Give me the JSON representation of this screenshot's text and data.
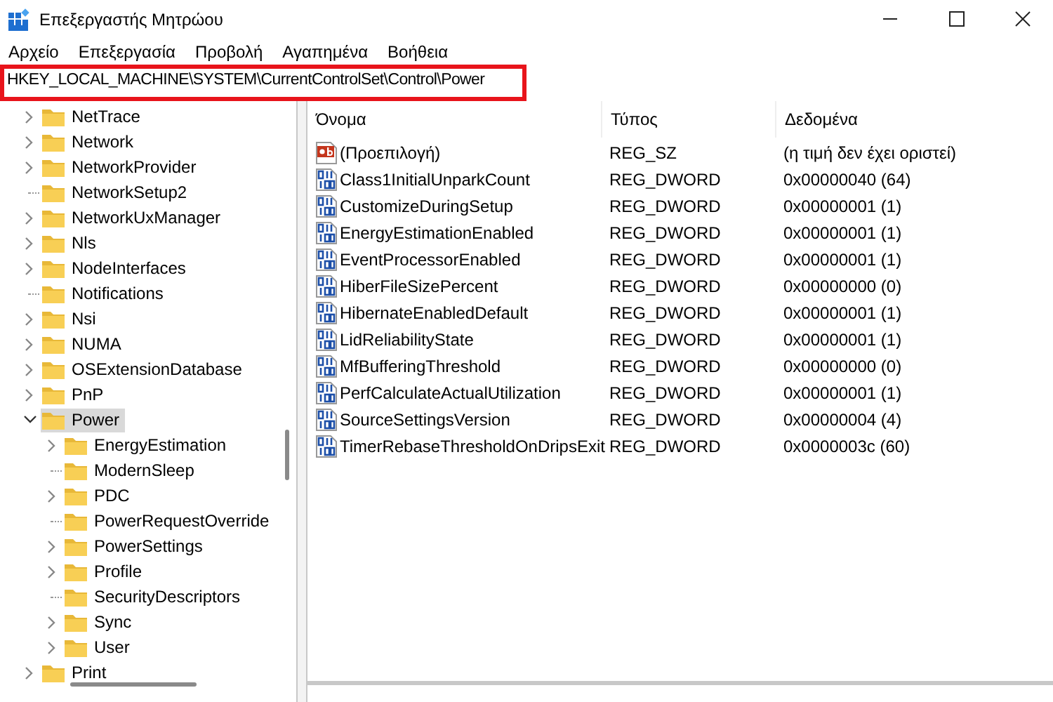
{
  "window": {
    "title": "Επεξεργαστής Μητρώου"
  },
  "menu": [
    "Αρχείο",
    "Επεξεργασία",
    "Προβολή",
    "Αγαπημένα",
    "Βοήθεια"
  ],
  "address_bar": {
    "value": "HKEY_LOCAL_MACHINE\\SYSTEM\\CurrentControlSet\\Control\\Power",
    "highlighted": true
  },
  "tree": [
    {
      "label": "NetTrace",
      "kind": "branch",
      "expanded": false,
      "selected": false
    },
    {
      "label": "Network",
      "kind": "branch",
      "expanded": false,
      "selected": false
    },
    {
      "label": "NetworkProvider",
      "kind": "branch",
      "expanded": false,
      "selected": false
    },
    {
      "label": "NetworkSetup2",
      "kind": "leaf",
      "selected": false
    },
    {
      "label": "NetworkUxManager",
      "kind": "branch",
      "expanded": false,
      "selected": false
    },
    {
      "label": "Nls",
      "kind": "branch",
      "expanded": false,
      "selected": false
    },
    {
      "label": "NodeInterfaces",
      "kind": "branch",
      "expanded": false,
      "selected": false
    },
    {
      "label": "Notifications",
      "kind": "leaf",
      "selected": false
    },
    {
      "label": "Nsi",
      "kind": "branch",
      "expanded": false,
      "selected": false
    },
    {
      "label": "NUMA",
      "kind": "branch",
      "expanded": false,
      "selected": false
    },
    {
      "label": "OSExtensionDatabase",
      "kind": "branch",
      "expanded": false,
      "selected": false
    },
    {
      "label": "PnP",
      "kind": "branch",
      "expanded": false,
      "selected": false
    },
    {
      "label": "Power",
      "kind": "branch",
      "expanded": true,
      "selected": true,
      "children": [
        {
          "label": "EnergyEstimation",
          "kind": "branch",
          "expanded": false,
          "selected": false
        },
        {
          "label": "ModernSleep",
          "kind": "leaf",
          "selected": false
        },
        {
          "label": "PDC",
          "kind": "branch",
          "expanded": false,
          "selected": false
        },
        {
          "label": "PowerRequestOverride",
          "kind": "leaf",
          "selected": false
        },
        {
          "label": "PowerSettings",
          "kind": "branch",
          "expanded": false,
          "selected": false
        },
        {
          "label": "Profile",
          "kind": "branch",
          "expanded": false,
          "selected": false
        },
        {
          "label": "SecurityDescriptors",
          "kind": "leaf",
          "selected": false
        },
        {
          "label": "Sync",
          "kind": "branch",
          "expanded": false,
          "selected": false
        },
        {
          "label": "User",
          "kind": "branch",
          "expanded": false,
          "selected": false
        }
      ]
    },
    {
      "label": "Print",
      "kind": "branch",
      "expanded": false,
      "selected": false
    }
  ],
  "table": {
    "columns": [
      "Όνομα",
      "Τύπος",
      "Δεδομένα"
    ],
    "rows": [
      {
        "kind": "string",
        "name": "(Προεπιλογή)",
        "type": "REG_SZ",
        "data": "(η τιμή δεν έχει οριστεί)"
      },
      {
        "kind": "binary",
        "name": "Class1InitialUnparkCount",
        "type": "REG_DWORD",
        "data": "0x00000040 (64)"
      },
      {
        "kind": "binary",
        "name": "CustomizeDuringSetup",
        "type": "REG_DWORD",
        "data": "0x00000001 (1)"
      },
      {
        "kind": "binary",
        "name": "EnergyEstimationEnabled",
        "type": "REG_DWORD",
        "data": "0x00000001 (1)"
      },
      {
        "kind": "binary",
        "name": "EventProcessorEnabled",
        "type": "REG_DWORD",
        "data": "0x00000001 (1)"
      },
      {
        "kind": "binary",
        "name": "HiberFileSizePercent",
        "type": "REG_DWORD",
        "data": "0x00000000 (0)"
      },
      {
        "kind": "binary",
        "name": "HibernateEnabledDefault",
        "type": "REG_DWORD",
        "data": "0x00000001 (1)"
      },
      {
        "kind": "binary",
        "name": "LidReliabilityState",
        "type": "REG_DWORD",
        "data": "0x00000001 (1)"
      },
      {
        "kind": "binary",
        "name": "MfBufferingThreshold",
        "type": "REG_DWORD",
        "data": "0x00000000 (0)"
      },
      {
        "kind": "binary",
        "name": "PerfCalculateActualUtilization",
        "type": "REG_DWORD",
        "data": "0x00000001 (1)"
      },
      {
        "kind": "binary",
        "name": "SourceSettingsVersion",
        "type": "REG_DWORD",
        "data": "0x00000004 (4)"
      },
      {
        "kind": "binary",
        "name": "TimerRebaseThresholdOnDripsExit",
        "type": "REG_DWORD",
        "data": "0x0000003c (60)"
      }
    ]
  }
}
